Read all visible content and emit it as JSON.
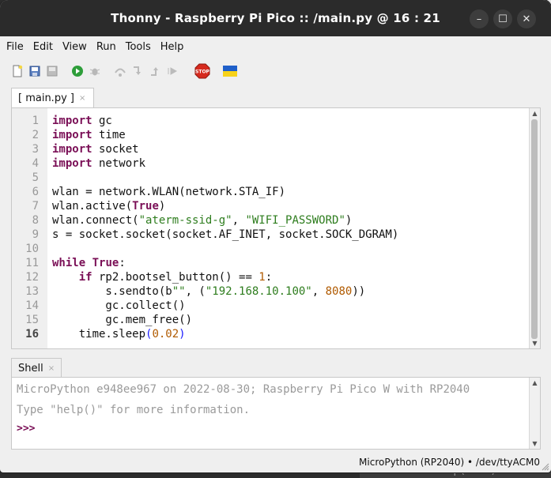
{
  "window": {
    "title": "Thonny  -  Raspberry Pi Pico :: /main.py  @  16 : 21"
  },
  "window_controls": {
    "minimize": "–",
    "maximize": "☐",
    "close": "✕"
  },
  "menu": [
    "File",
    "Edit",
    "View",
    "Run",
    "Tools",
    "Help"
  ],
  "toolbar": {
    "icons": [
      "new-file-icon",
      "open-file-icon",
      "save-file-icon",
      "run-icon",
      "debug-icon",
      "step-over-icon",
      "step-into-icon",
      "step-out-icon",
      "resume-icon",
      "stop-icon",
      "ukraine-flag-icon"
    ],
    "stop_label": "STOP"
  },
  "editor_tab": {
    "label": "[ main.py ]",
    "close": "×"
  },
  "editor": {
    "current_line": 16,
    "line_numbers": [
      "1",
      "2",
      "3",
      "4",
      "5",
      "6",
      "7",
      "8",
      "9",
      "10",
      "11",
      "12",
      "13",
      "14",
      "15",
      "16"
    ]
  },
  "shell_tab": {
    "label": "Shell",
    "close": "×"
  },
  "shell": {
    "banner": "MicroPython e948ee967 on 2022-08-30; Raspberry Pi Pico W with RP2040",
    "help": "Type \"help()\" for more information.",
    "prompt": ">>>"
  },
  "status": {
    "interpreter": "MicroPython (RP2040)  •  /dev/ttyACM0"
  },
  "background_peek": {
    "text": "time.sleep(0.02)"
  },
  "colors": {
    "keyword": "#7a0f56",
    "string": "#2e7d1e",
    "number": "#b05a00",
    "titlebar": "#2b2b2b"
  }
}
